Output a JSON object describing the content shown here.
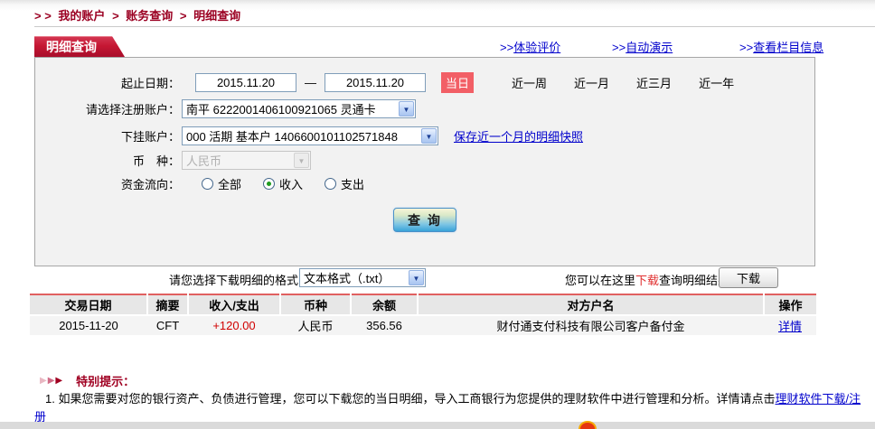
{
  "page": {
    "breadcrumb": {
      "prefix": "> >",
      "separator": ">",
      "items": [
        "我的账户",
        "账务查询",
        "明细查询"
      ]
    },
    "tab_title": "明细查询",
    "top_links": [
      {
        "prefix": ">>",
        "label": "体验评价"
      },
      {
        "prefix": ">>",
        "label": "自动演示"
      },
      {
        "prefix": ">>",
        "label": "查看栏目信息"
      }
    ]
  },
  "form": {
    "date_label": "起止日期：",
    "date_from": "2015.11.20",
    "date_to": "2015.11.20",
    "date_separator": "—",
    "quick_ranges": [
      {
        "label": "当日",
        "active": true
      },
      {
        "label": "近一周",
        "active": false
      },
      {
        "label": "近一月",
        "active": false
      },
      {
        "label": "近三月",
        "active": false
      },
      {
        "label": "近一年",
        "active": false
      }
    ],
    "account_label": "请选择注册账户：",
    "account_value": "南平 6222001406100921065 灵通卡",
    "sub_account_label": "下挂账户：",
    "sub_account_value": "000 活期 基本户 1406600101102571848",
    "snapshot_link": "保存近一个月的明细快照",
    "currency_label": "币　种：",
    "currency_value": "人民币",
    "flow_label": "资金流向：",
    "flow_options": [
      {
        "label": "全部",
        "checked": false
      },
      {
        "label": "收入",
        "checked": true
      },
      {
        "label": "支出",
        "checked": false
      }
    ],
    "query_button": "查 询"
  },
  "download": {
    "format_label": "请您选择下载明细的格式",
    "format_value": "文本格式（.txt）",
    "hint_before": "您可以在这里",
    "hint_highlight": "下载",
    "hint_after": "查询明细结果",
    "button": "下载"
  },
  "table": {
    "headers": [
      "交易日期",
      "摘要",
      "收入/支出",
      "币种",
      "余额",
      "对方户名",
      "操作"
    ],
    "rows": [
      {
        "date": "2015-11-20",
        "summary": "CFT",
        "amount": "+120.00",
        "currency": "人民币",
        "balance": "356.56",
        "counterparty": "财付通支付科技有限公司客户备付金",
        "action": "详情"
      }
    ]
  },
  "notes": {
    "title": "特别提示：",
    "item_text": "1. 如果您需要对您的银行资产、负债进行管理，您可以下载您的当日明细，导入工商银行为您提供的理财软件中进行管理和分析。详情请点击",
    "item_link": "理财软件下载/注册"
  },
  "colors": {
    "brand_red": "#b01030",
    "link_blue": "#0000cc",
    "amount_red": "#d00000",
    "active_range_bg": "#f25f66"
  }
}
